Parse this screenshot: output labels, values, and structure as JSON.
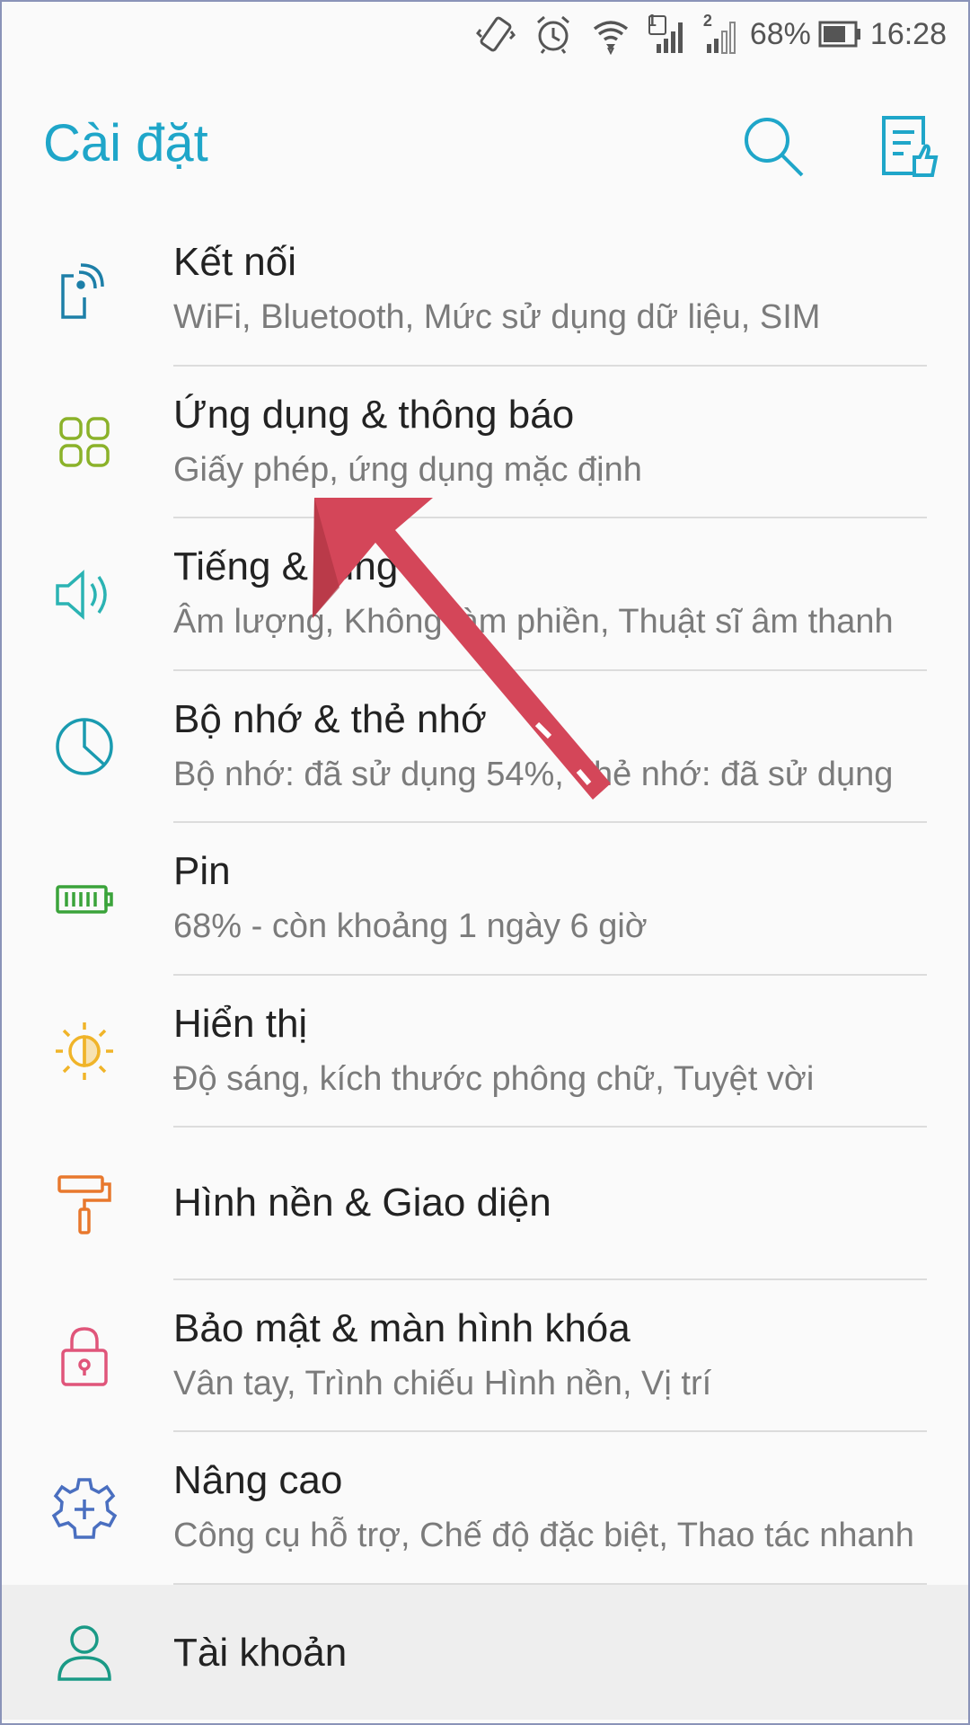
{
  "status_bar": {
    "battery_percent": "68%",
    "time": "16:28",
    "sim1": "1",
    "sim2": "2",
    "icons": [
      "vibrate-icon",
      "alarm-icon",
      "wifi-icon",
      "signal-sim1-icon",
      "signal-sim2-icon",
      "battery-icon"
    ]
  },
  "app_bar": {
    "title": "Cài đặt",
    "accent_color": "#1fa6c9"
  },
  "settings": [
    {
      "title": "Kết nối",
      "subtitle": "WiFi, Bluetooth, Mức sử dụng dữ liệu, SIM",
      "icon": "connection-icon",
      "color": "#1d7fa8"
    },
    {
      "title": "Ứng dụng & thông báo",
      "subtitle": "Giấy phép, ứng dụng mặc định",
      "icon": "apps-grid-icon",
      "color": "#8bb22a"
    },
    {
      "title": "Tiếng & rung",
      "subtitle": "Âm lượng, Không làm phiền, Thuật sĩ âm thanh",
      "icon": "speaker-icon",
      "color": "#2bb3b3"
    },
    {
      "title": "Bộ nhớ & thẻ nhớ",
      "subtitle": "Bộ nhớ: đã sử dụng 54%, Thẻ nhớ: đã sử dụng",
      "icon": "storage-pie-icon",
      "color": "#1a9bb0"
    },
    {
      "title": "Pin",
      "subtitle": "68% - còn khoảng 1 ngày 6 giờ",
      "icon": "battery-icon",
      "color": "#3aa33a"
    },
    {
      "title": "Hiển thị",
      "subtitle": "Độ sáng, kích thước phông chữ, Tuyệt vời",
      "icon": "brightness-icon",
      "color": "#f0b429"
    },
    {
      "title": "Hình nền & Giao diện",
      "subtitle": "",
      "icon": "paint-roller-icon",
      "color": "#e8782d"
    },
    {
      "title": "Bảo mật & màn hình khóa",
      "subtitle": "Vân tay, Trình chiếu Hình nền, Vị trí",
      "icon": "lock-icon",
      "color": "#e0557a"
    },
    {
      "title": "Nâng cao",
      "subtitle": "Công cụ hỗ trợ, Chế độ đặc biệt, Thao tác nhanh",
      "icon": "gear-plus-icon",
      "color": "#4a6fc0"
    },
    {
      "title": "Tài khoản",
      "subtitle": "",
      "icon": "account-icon",
      "color": "#1a9a86"
    }
  ],
  "annotation": {
    "color": "#d44659"
  }
}
